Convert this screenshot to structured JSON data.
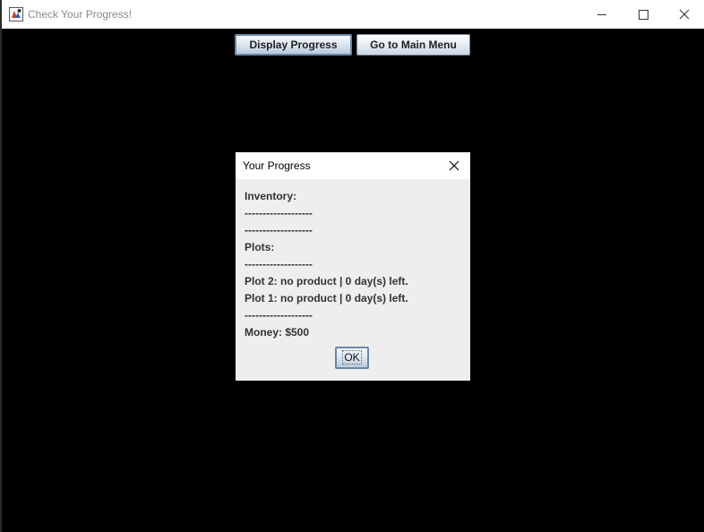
{
  "window": {
    "title": "Check Your Progress!",
    "controls": [
      "minimize",
      "maximize",
      "close"
    ]
  },
  "toolbar": {
    "display_progress_label": "Display Progress",
    "main_menu_label": "Go to Main Menu"
  },
  "dialog": {
    "title": "Your Progress",
    "lines": [
      "Inventory:",
      "-------------------",
      "-------------------",
      "Plots:",
      "-------------------",
      "Plot 2: no product | 0 day(s) left.",
      "Plot 1: no product | 0 day(s) left.",
      "-------------------",
      "Money: $500"
    ],
    "ok_label": "OK"
  },
  "colors": {
    "background": "#000000",
    "dialog_background": "#eeeeee",
    "titlebar": "#ffffff",
    "button_border": "#6b86a8"
  }
}
